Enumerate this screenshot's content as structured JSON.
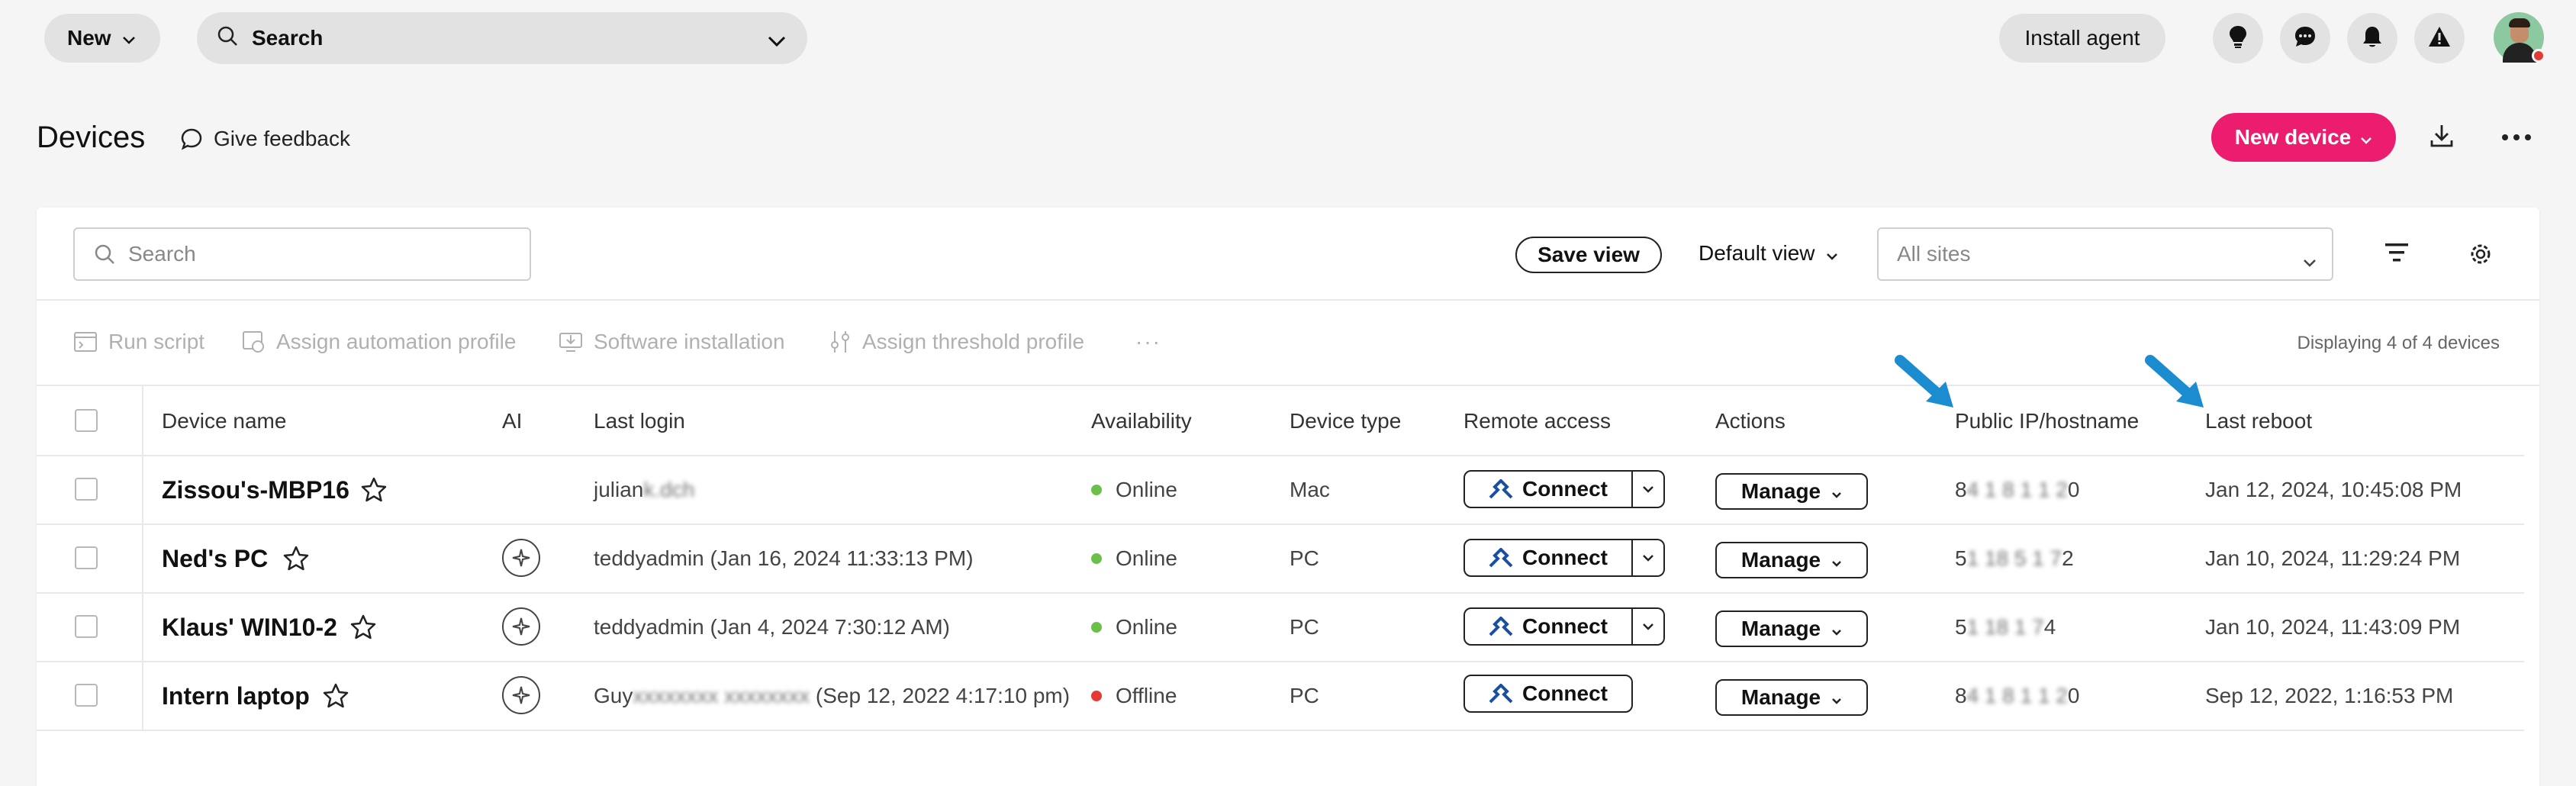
{
  "topbar": {
    "new_label": "New",
    "search_label": "Search",
    "install_label": "Install agent",
    "icons": [
      "lightbulb-icon",
      "chat-icon",
      "bell-icon",
      "warning-icon"
    ]
  },
  "header": {
    "title": "Devices",
    "feedback_label": "Give feedback",
    "new_device_label": "New device"
  },
  "toolbar": {
    "search_placeholder": "Search",
    "save_view_label": "Save view",
    "default_view_label": "Default view",
    "sites_placeholder": "All sites"
  },
  "bulk_actions": {
    "run_script": "Run script",
    "assign_automation": "Assign automation profile",
    "software_install": "Software installation",
    "assign_threshold": "Assign threshold profile",
    "more": "···",
    "displaying": "Displaying 4 of 4 devices"
  },
  "columns": {
    "device_name": "Device name",
    "ai": "AI",
    "last_login": "Last login",
    "availability": "Availability",
    "device_type": "Device type",
    "remote_access": "Remote access",
    "actions": "Actions",
    "public_ip": "Public IP/hostname",
    "last_reboot": "Last reboot"
  },
  "colors": {
    "accent": "#ec1c6e",
    "online": "#6cc04a",
    "offline": "#e53935",
    "arrow": "#1a8ccf"
  },
  "rows": [
    {
      "name": "Zissou's-MBP16",
      "login_visible": "julian",
      "login_blurred": "k.dch",
      "login_rest": "",
      "availability": "Online",
      "type": "Mac",
      "connect": "Connect",
      "manage": "Manage",
      "ip_start": "8",
      "ip_blurred": "4 1 8 1 1 2",
      "ip_end": "0",
      "reboot": "Jan 12, 2024, 10:45:08 PM"
    },
    {
      "name": "Ned's PC",
      "login_visible": "teddyadmin (Jan 16, 2024 11:33:13 PM)",
      "login_blurred": "",
      "login_rest": "",
      "availability": "Online",
      "type": "PC",
      "connect": "Connect",
      "manage": "Manage",
      "ip_start": "5",
      "ip_blurred": "1 18 5 1 7",
      "ip_end": "2",
      "reboot": "Jan 10, 2024, 11:29:24 PM"
    },
    {
      "name": "Klaus' WIN10-2",
      "login_visible": "teddyadmin (Jan 4, 2024 7:30:12 AM)",
      "login_blurred": "",
      "login_rest": "",
      "availability": "Online",
      "type": "PC",
      "connect": "Connect",
      "manage": "Manage",
      "ip_start": "5",
      "ip_blurred": "1 18 1 7",
      "ip_end": "4",
      "reboot": "Jan 10, 2024, 11:43:09 PM"
    },
    {
      "name": "Intern laptop",
      "login_visible": "Guy",
      "login_blurred": "xxxxxxxx xxxxxxxx",
      "login_rest": " (Sep 12, 2022 4:17:10 pm)",
      "availability": "Offline",
      "type": "PC",
      "connect": "Connect",
      "manage": "Manage",
      "ip_start": "8",
      "ip_blurred": "4 1 8 1 1 2",
      "ip_end": "0",
      "reboot": "Sep 12, 2022, 1:16:53 PM"
    }
  ]
}
